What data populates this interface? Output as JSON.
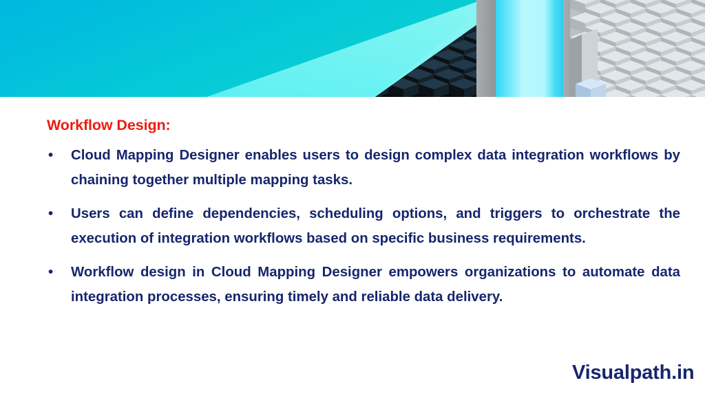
{
  "slide": {
    "title": "Workflow Design:",
    "title_color": "#ee1b11",
    "body_color": "#16266d",
    "background_color": "#ffffff",
    "bullet_marker": "•",
    "bullets": [
      "Cloud Mapping Designer enables users to design complex data integration workflows by chaining together multiple mapping tasks.",
      "Users can define dependencies, scheduling options, and triggers to orchestrate the execution of integration workflows based on specific business requirements.",
      "Workflow design in Cloud Mapping Designer empowers organizations to automate data integration processes, ensuring timely and reliable data delivery."
    ],
    "footer_logo": "Visualpath.in"
  },
  "banner": {
    "description": "3D isometric technology render banner",
    "gradient_left": "#00b9dd",
    "gradient_mid": "#0ad2d2",
    "plane_light": "#6ef0f0",
    "dark_cubes": "#1e3440",
    "dark_cubes_shadow": "#0a1014",
    "pillar_gray": "#9fa3a5",
    "glow_cyan": "#aaf6fb",
    "glow_cyan_edge": "#3fd8f5",
    "light_cubes_top": "#dfe6e8",
    "light_cubes_side": "#a8b0b4",
    "light_cubes_front": "#c3cace",
    "accent_cube": "#cfe2f5"
  }
}
